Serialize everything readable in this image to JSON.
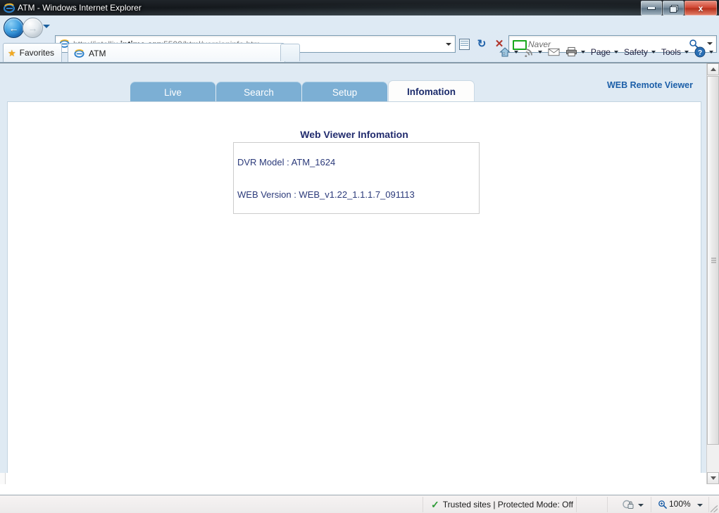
{
  "window": {
    "title": "ATM - Windows Internet Explorer",
    "minimize_label": "Minimize",
    "restore_label": "Restore",
    "close_label": "x"
  },
  "navigation": {
    "back_label": "←",
    "forward_label": "→",
    "address_url_prefix": "http://intellix.",
    "address_url_domain": "iptime.org",
    "address_url_suffix": ":5500/html/versioninfo.htm",
    "address_full": "http://intellix.iptime.org:5500/html/versioninfo.htm",
    "compat_tooltip": "Compatibility View",
    "refresh_label": "↻",
    "stop_label": "✕",
    "search_provider": "Naver",
    "search_placeholder": "Naver"
  },
  "toolbar": {
    "favorites_label": "Favorites",
    "browser_tab_label": "ATM",
    "new_tab_label": "",
    "items": [
      {
        "label": "Page"
      },
      {
        "label": "Safety"
      },
      {
        "label": "Tools"
      }
    ]
  },
  "page": {
    "remote_viewer_label": "WEB Remote Viewer",
    "tabs": [
      {
        "label": "Live",
        "active": false
      },
      {
        "label": "Search",
        "active": false
      },
      {
        "label": "Setup",
        "active": false
      },
      {
        "label": "Infomation",
        "active": true
      }
    ],
    "card_title": "Web Viewer Infomation",
    "info": {
      "dvr_model": "DVR Model : ATM_1624",
      "web_version": "WEB Version : WEB_v1.22_1.1.1.7_091113"
    }
  },
  "status": {
    "security_zone": "Trusted sites | Protected Mode: Off",
    "zoom_level": "100%"
  },
  "colors": {
    "tab_blue": "#7cafd4",
    "accent_navy": "#222c6e",
    "link_blue": "#1c5fa8",
    "page_bg": "#dfeaf3",
    "status_green": "#2d9b36"
  }
}
